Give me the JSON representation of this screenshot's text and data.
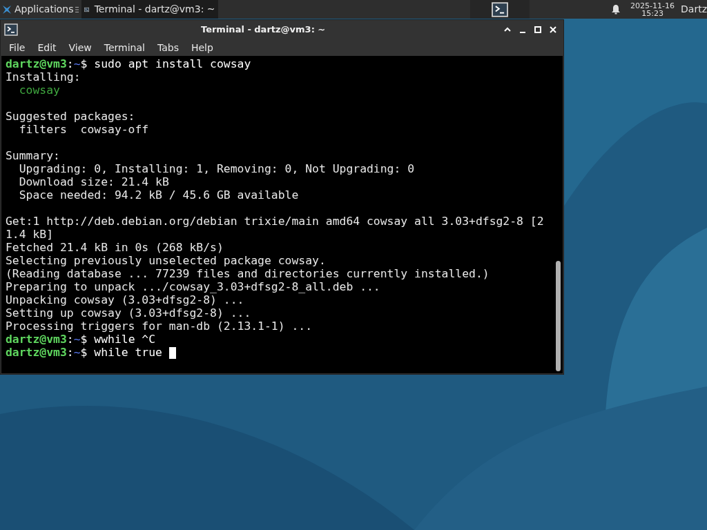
{
  "panel": {
    "app_menu": "Applications",
    "tasks": [
      {
        "label": "Terminal - dartz@vm3: ~",
        "selected": true
      }
    ],
    "clock": {
      "date": "2025-11-16",
      "time": "15:23"
    },
    "user": "Dartz"
  },
  "window": {
    "title": "Terminal - dartz@vm3: ~",
    "menu": [
      "File",
      "Edit",
      "View",
      "Terminal",
      "Tabs",
      "Help"
    ]
  },
  "terminal": {
    "lines": [
      {
        "kind": "prompt",
        "user_host": "dartz@vm3",
        "sep": ":",
        "path": "~",
        "symbol": "$",
        "command": "sudo apt install cowsay",
        "cursor": false
      },
      {
        "kind": "output",
        "text": "Installing:"
      },
      {
        "kind": "package",
        "text": "  cowsay"
      },
      {
        "kind": "blank"
      },
      {
        "kind": "output",
        "text": "Suggested packages:"
      },
      {
        "kind": "output",
        "text": "  filters  cowsay-off"
      },
      {
        "kind": "blank"
      },
      {
        "kind": "output",
        "text": "Summary:"
      },
      {
        "kind": "output",
        "text": "  Upgrading: 0, Installing: 1, Removing: 0, Not Upgrading: 0"
      },
      {
        "kind": "output",
        "text": "  Download size: 21.4 kB"
      },
      {
        "kind": "output",
        "text": "  Space needed: 94.2 kB / 45.6 GB available"
      },
      {
        "kind": "blank"
      },
      {
        "kind": "output",
        "text": "Get:1 http://deb.debian.org/debian trixie/main amd64 cowsay all 3.03+dfsg2-8 [2"
      },
      {
        "kind": "output",
        "text": "1.4 kB]"
      },
      {
        "kind": "output",
        "text": "Fetched 21.4 kB in 0s (268 kB/s)"
      },
      {
        "kind": "output",
        "text": "Selecting previously unselected package cowsay."
      },
      {
        "kind": "output",
        "text": "(Reading database ... 77239 files and directories currently installed.)"
      },
      {
        "kind": "output",
        "text": "Preparing to unpack .../cowsay_3.03+dfsg2-8_all.deb ..."
      },
      {
        "kind": "output",
        "text": "Unpacking cowsay (3.03+dfsg2-8) ..."
      },
      {
        "kind": "output",
        "text": "Setting up cowsay (3.03+dfsg2-8) ..."
      },
      {
        "kind": "output",
        "text": "Processing triggers for man-db (2.13.1-1) ..."
      },
      {
        "kind": "prompt",
        "user_host": "dartz@vm3",
        "sep": ":",
        "path": "~",
        "symbol": "$",
        "command": "wwhile ^C",
        "cursor": false
      },
      {
        "kind": "prompt",
        "user_host": "dartz@vm3",
        "sep": ":",
        "path": "~",
        "symbol": "$",
        "command": "while true ",
        "cursor": true
      }
    ]
  }
}
